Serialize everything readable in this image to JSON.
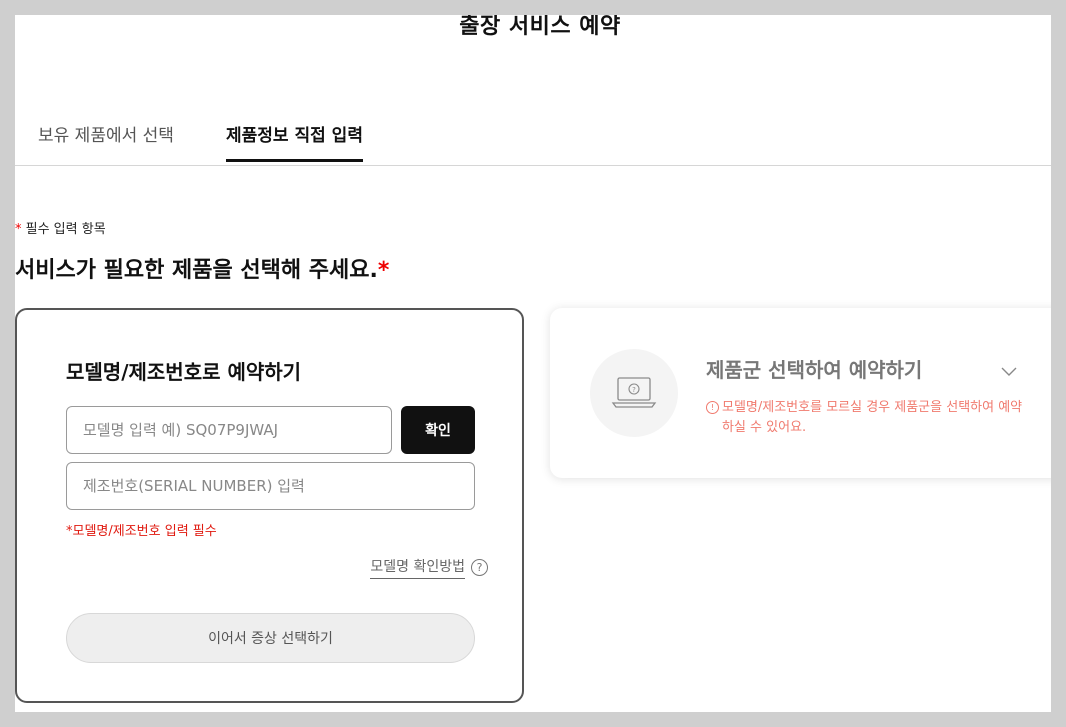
{
  "page": {
    "title": "출장 서비스 예약"
  },
  "tabs": [
    {
      "label": "보유 제품에서 선택",
      "active": false
    },
    {
      "label": "제품정보 직접 입력",
      "active": true
    }
  ],
  "required_note": {
    "star": "*",
    "text": " 필수 입력 항목"
  },
  "section": {
    "title": "서비스가 필요한 제품을 선택해 주세요.",
    "star": "*"
  },
  "model_card": {
    "title": "모델명/제조번호로 예약하기",
    "model_input": {
      "placeholder": "모델명 입력 예) SQ07P9JWAJ",
      "value": ""
    },
    "confirm_label": "확인",
    "serial_input": {
      "placeholder": "제조번호(SERIAL NUMBER) 입력",
      "value": ""
    },
    "error_text": "*모델명/제조번호 입력 필수",
    "help_link": "모델명 확인방법",
    "help_icon_text": "?",
    "next_button": "이어서 증상 선택하기"
  },
  "category_card": {
    "icon": "laptop-question-icon",
    "title": "제품군 선택하여 예약하기",
    "notice_icon_text": "!",
    "notice": "모델명/제조번호를 모르실 경우 제품군을 선택하여 예약하실 수 있어요."
  },
  "colors": {
    "background": "#cfcfcf",
    "primary_button": "#111111",
    "error": "#e0190f",
    "notice": "#f07a6e",
    "required_star": "#e00000"
  }
}
